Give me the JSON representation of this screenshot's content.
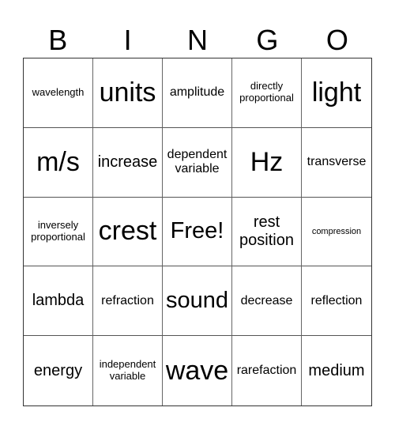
{
  "header": [
    "B",
    "I",
    "N",
    "G",
    "O"
  ],
  "cells": [
    {
      "text": "wavelength",
      "size": "s"
    },
    {
      "text": "units",
      "size": "xxl"
    },
    {
      "text": "amplitude",
      "size": "m"
    },
    {
      "text": "directly proportional",
      "size": "s"
    },
    {
      "text": "light",
      "size": "xxl"
    },
    {
      "text": "m/s",
      "size": "xxl"
    },
    {
      "text": "increase",
      "size": "l"
    },
    {
      "text": "dependent variable",
      "size": "m"
    },
    {
      "text": "Hz",
      "size": "xxl"
    },
    {
      "text": "transverse",
      "size": "m"
    },
    {
      "text": "inversely proportional",
      "size": "s"
    },
    {
      "text": "crest",
      "size": "xxl"
    },
    {
      "text": "Free!",
      "size": "xl"
    },
    {
      "text": "rest position",
      "size": "l"
    },
    {
      "text": "compression",
      "size": "xs"
    },
    {
      "text": "lambda",
      "size": "l"
    },
    {
      "text": "refraction",
      "size": "m"
    },
    {
      "text": "sound",
      "size": "xl"
    },
    {
      "text": "decrease",
      "size": "m"
    },
    {
      "text": "reflection",
      "size": "m"
    },
    {
      "text": "energy",
      "size": "l"
    },
    {
      "text": "independent variable",
      "size": "s"
    },
    {
      "text": "wave",
      "size": "xxl"
    },
    {
      "text": "rarefaction",
      "size": "m"
    },
    {
      "text": "medium",
      "size": "l"
    }
  ]
}
